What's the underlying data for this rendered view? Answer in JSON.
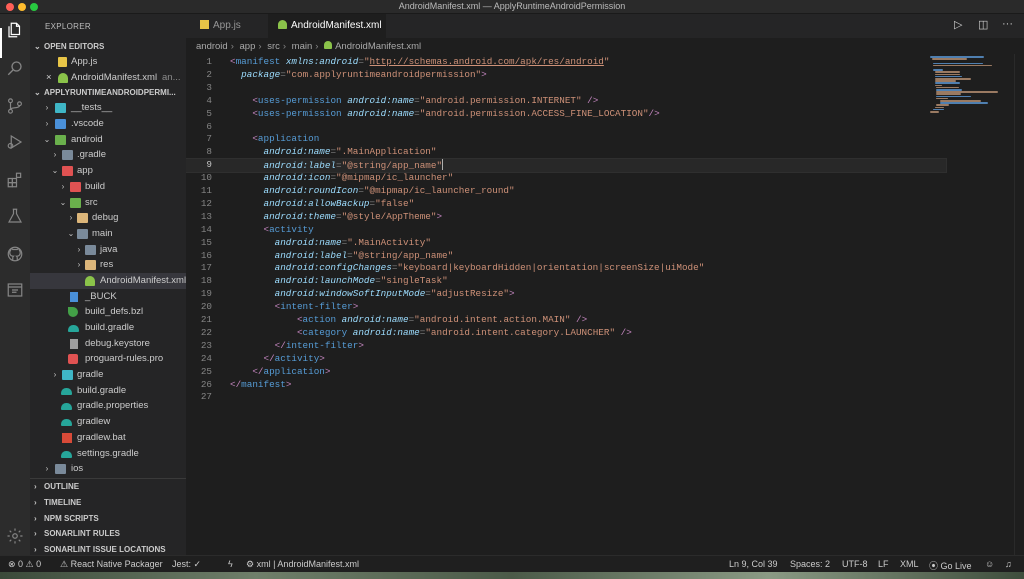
{
  "window": {
    "title": "AndroidManifest.xml — ApplyRuntimeAndroidPermission"
  },
  "sidebar": {
    "header": "EXPLORER",
    "open_editors": {
      "title": "OPEN EDITORS",
      "items": [
        {
          "label": "App.js"
        },
        {
          "label": "AndroidManifest.xml",
          "suffix": "an..."
        }
      ]
    },
    "project": {
      "title": "APPLYRUNTIMEANDROIDPERMI...",
      "tree": [
        {
          "label": "__tests__"
        },
        {
          "label": ".vscode"
        },
        {
          "label": "android"
        },
        {
          "label": ".gradle"
        },
        {
          "label": "app"
        },
        {
          "label": "build"
        },
        {
          "label": "src"
        },
        {
          "label": "debug"
        },
        {
          "label": "main"
        },
        {
          "label": "java"
        },
        {
          "label": "res"
        },
        {
          "label": "AndroidManifest.xml"
        },
        {
          "label": "_BUCK"
        },
        {
          "label": "build_defs.bzl"
        },
        {
          "label": "build.gradle"
        },
        {
          "label": "debug.keystore"
        },
        {
          "label": "proguard-rules.pro"
        },
        {
          "label": "gradle"
        },
        {
          "label": "build.gradle"
        },
        {
          "label": "gradle.properties"
        },
        {
          "label": "gradlew"
        },
        {
          "label": "gradlew.bat"
        },
        {
          "label": "settings.gradle"
        },
        {
          "label": "ios"
        }
      ]
    },
    "sections": [
      "OUTLINE",
      "TIMELINE",
      "NPM SCRIPTS",
      "SONARLINT RULES",
      "SONARLINT ISSUE LOCATIONS"
    ]
  },
  "tabs": [
    {
      "label": "App.js"
    },
    {
      "label": "AndroidManifest.xml"
    }
  ],
  "breadcrumb": [
    "android",
    "app",
    "src",
    "main",
    "AndroidManifest.xml"
  ],
  "editor": {
    "current_line": 9,
    "lines": [
      "<manifest xmlns:android=\"http://schemas.android.com/apk/res/android\"",
      "  package=\"com.applyruntimeandroidpermission\">",
      "",
      "    <uses-permission android:name=\"android.permission.INTERNET\" />",
      "    <uses-permission android:name=\"android.permission.ACCESS_FINE_LOCATION\"/>",
      "",
      "    <application",
      "      android:name=\".MainApplication\"",
      "      android:label=\"@string/app_name\"",
      "      android:icon=\"@mipmap/ic_launcher\"",
      "      android:roundIcon=\"@mipmap/ic_launcher_round\"",
      "      android:allowBackup=\"false\"",
      "      android:theme=\"@style/AppTheme\">",
      "      <activity",
      "        android:name=\".MainActivity\"",
      "        android:label=\"@string/app_name\"",
      "        android:configChanges=\"keyboard|keyboardHidden|orientation|screenSize|uiMode\"",
      "        android:launchMode=\"singleTask\"",
      "        android:windowSoftInputMode=\"adjustResize\">",
      "        <intent-filter>",
      "            <action android:name=\"android.intent.action.MAIN\" />",
      "            <category android:name=\"android.intent.category.LAUNCHER\" />",
      "        </intent-filter>",
      "      </activity>",
      "    </application>",
      "</manifest>",
      ""
    ]
  },
  "status": {
    "problems": "⊗ 0 ⚠ 0",
    "react_native": "React Native Packager",
    "jest": "Jest: ✓",
    "language_info": "xml | AndroidManifest.xml",
    "position": "Ln 9, Col 39",
    "spaces": "Spaces: 2",
    "encoding": "UTF-8",
    "eol": "LF",
    "language": "XML",
    "golive": "Go Live"
  },
  "colors": {
    "editor_bg": "#1e1e1e",
    "sidebar_bg": "#252526",
    "tag": "#569cd6",
    "attribute": "#9cdcfe",
    "string": "#ce9178"
  }
}
